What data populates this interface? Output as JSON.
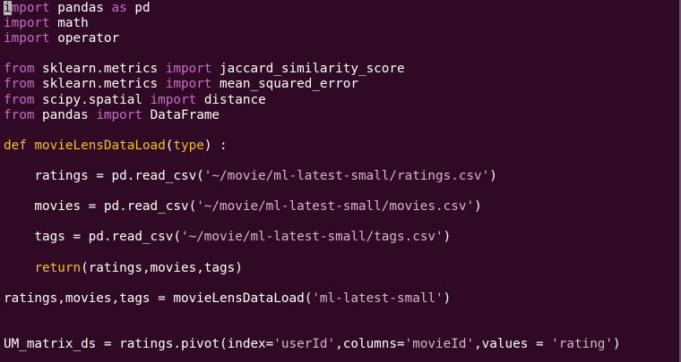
{
  "editor": {
    "colors": {
      "background": "#300a24",
      "text": "#ffffff",
      "keyword": "#c86bc8",
      "def_keyword": "#f0c318",
      "string": "#d5b4cc",
      "cursor": "#b8b8b8"
    },
    "cursor": {
      "line": 1,
      "column": 1
    },
    "lines": [
      [
        [
          "cursor",
          "i"
        ],
        [
          "kw",
          "mport"
        ],
        [
          "t",
          " pandas "
        ],
        [
          "kw",
          "as"
        ],
        [
          "t",
          " pd"
        ]
      ],
      [
        [
          "kw",
          "import"
        ],
        [
          "t",
          " math"
        ]
      ],
      [
        [
          "kw",
          "import"
        ],
        [
          "t",
          " operator"
        ]
      ],
      [],
      [
        [
          "kw",
          "from"
        ],
        [
          "t",
          " sklearn.metrics "
        ],
        [
          "kw",
          "import"
        ],
        [
          "t",
          " jaccard_similarity_score"
        ]
      ],
      [
        [
          "kw",
          "from"
        ],
        [
          "t",
          " sklearn.metrics "
        ],
        [
          "kw",
          "import"
        ],
        [
          "t",
          " mean_squared_error"
        ]
      ],
      [
        [
          "kw",
          "from"
        ],
        [
          "t",
          " scipy.spatial "
        ],
        [
          "kw",
          "import"
        ],
        [
          "t",
          " distance"
        ]
      ],
      [
        [
          "kw",
          "from"
        ],
        [
          "t",
          " pandas "
        ],
        [
          "kw",
          "import"
        ],
        [
          "t",
          " DataFrame"
        ]
      ],
      [],
      [
        [
          "df",
          "def"
        ],
        [
          "t",
          " "
        ],
        [
          "df",
          "movieLensDataLoad"
        ],
        [
          "t",
          "("
        ],
        [
          "df",
          "type"
        ],
        [
          "t",
          ") :"
        ]
      ],
      [],
      [
        [
          "t",
          "    ratings = pd.read_csv("
        ],
        [
          "str",
          "'~/movie/ml-latest-small/ratings.csv'"
        ],
        [
          "t",
          ")"
        ]
      ],
      [],
      [
        [
          "t",
          "    movies = pd.read_csv("
        ],
        [
          "str",
          "'~/movie/ml-latest-small/movies.csv'"
        ],
        [
          "t",
          ")"
        ]
      ],
      [],
      [
        [
          "t",
          "    tags = pd.read_csv("
        ],
        [
          "str",
          "'~/movie/ml-latest-small/tags.csv'"
        ],
        [
          "t",
          ")"
        ]
      ],
      [],
      [
        [
          "t",
          "    "
        ],
        [
          "df",
          "return"
        ],
        [
          "t",
          "(ratings,movies,tags)"
        ]
      ],
      [],
      [
        [
          "t",
          "ratings,movies,tags = movieLensDataLoad("
        ],
        [
          "str",
          "'ml-latest-small'"
        ],
        [
          "t",
          ")"
        ]
      ],
      [],
      [],
      [
        [
          "t",
          "UM_matrix_ds = ratings.pivot(index="
        ],
        [
          "str",
          "'userId'"
        ],
        [
          "t",
          ",columns="
        ],
        [
          "str",
          "'movieId'"
        ],
        [
          "t",
          ",values = "
        ],
        [
          "str",
          "'rating'"
        ],
        [
          "t",
          ")"
        ]
      ]
    ]
  }
}
